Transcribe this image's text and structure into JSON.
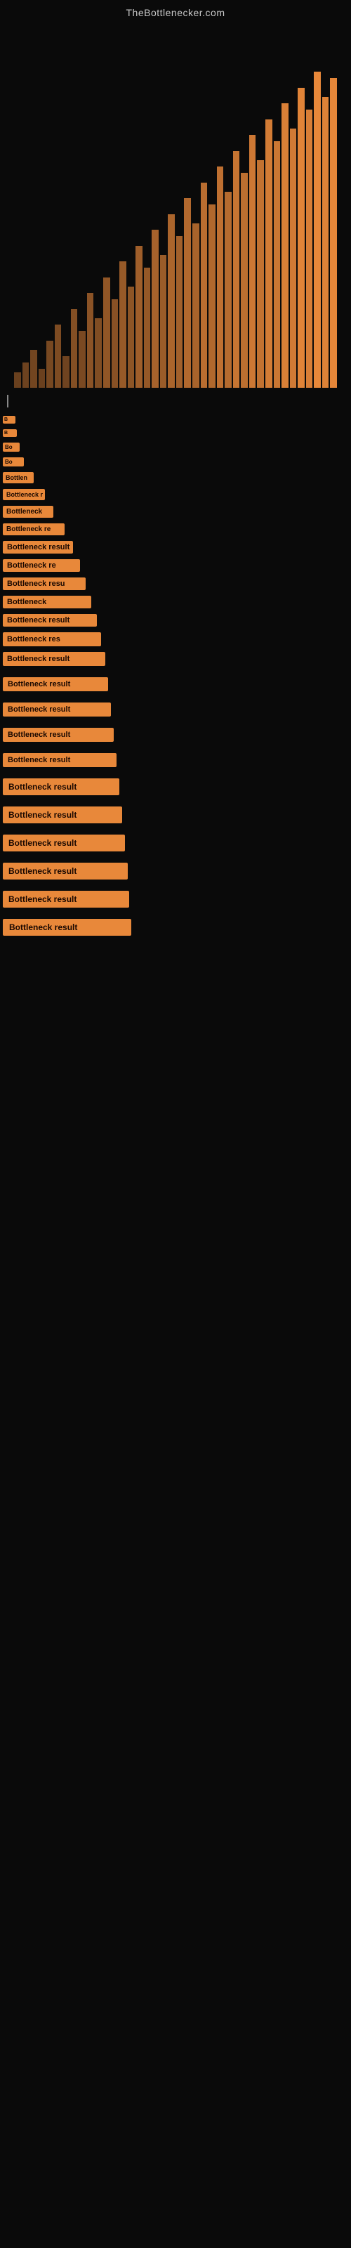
{
  "site": {
    "title": "TheBottlenecker.com"
  },
  "results": [
    {
      "label": "B",
      "class": "w1"
    },
    {
      "label": "B",
      "class": "w2"
    },
    {
      "label": "Bo",
      "class": "w3"
    },
    {
      "label": "Bo",
      "class": "w4"
    },
    {
      "label": "Bottlen",
      "class": "w5"
    },
    {
      "label": "Bottleneck r",
      "class": "w6"
    },
    {
      "label": "Bottleneck",
      "class": "w7"
    },
    {
      "label": "Bottleneck re",
      "class": "w8"
    },
    {
      "label": "Bottleneck result",
      "class": "w9"
    },
    {
      "label": "Bottleneck re",
      "class": "w10"
    },
    {
      "label": "Bottleneck resu",
      "class": "w11"
    },
    {
      "label": "Bottleneck",
      "class": "w12"
    },
    {
      "label": "Bottleneck result",
      "class": "w13"
    },
    {
      "label": "Bottleneck res",
      "class": "w14"
    },
    {
      "label": "Bottleneck result",
      "class": "w15"
    },
    {
      "label": "Bottleneck result",
      "class": "w16"
    },
    {
      "label": "Bottleneck result",
      "class": "w17"
    },
    {
      "label": "Bottleneck result",
      "class": "w18"
    },
    {
      "label": "Bottleneck result",
      "class": "w19"
    },
    {
      "label": "Bottleneck result",
      "class": "w20"
    },
    {
      "label": "Bottleneck result",
      "class": "w21"
    },
    {
      "label": "Bottleneck result",
      "class": "w22"
    },
    {
      "label": "Bottleneck result",
      "class": "w23"
    },
    {
      "label": "Bottleneck result",
      "class": "w24"
    },
    {
      "label": "Bottleneck result",
      "class": "w25"
    }
  ],
  "chart": {
    "bars": [
      5,
      8,
      12,
      6,
      15,
      20,
      10,
      25,
      18,
      30,
      22,
      35,
      28,
      40,
      32,
      45,
      38,
      50,
      42,
      55,
      48,
      60,
      52,
      65,
      58,
      70,
      62,
      75,
      68,
      80,
      72,
      85,
      78,
      90,
      82,
      95,
      88,
      100,
      92,
      98
    ]
  }
}
